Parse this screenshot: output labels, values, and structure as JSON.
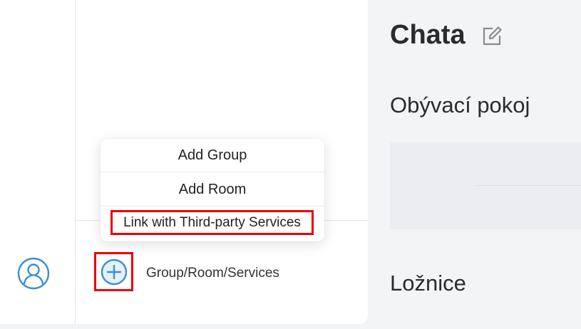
{
  "colors": {
    "accent": "#3a8fd4",
    "highlight_border": "#e8000b",
    "background": "#f3f4f6",
    "panel": "#ffffff"
  },
  "rail": {
    "avatar_icon": "user-avatar-icon"
  },
  "panel": {
    "add_button_icon": "plus-circle-icon",
    "add_label": "Group/Room/Services"
  },
  "popup": {
    "items": [
      {
        "label": "Add Group"
      },
      {
        "label": "Add Room"
      },
      {
        "label": "Link with Third-party Services"
      }
    ]
  },
  "main": {
    "home_title": "Chata",
    "edit_icon": "edit-icon",
    "rooms": [
      {
        "name": "Obývací pokoj"
      },
      {
        "name": "Ložnice"
      }
    ]
  }
}
